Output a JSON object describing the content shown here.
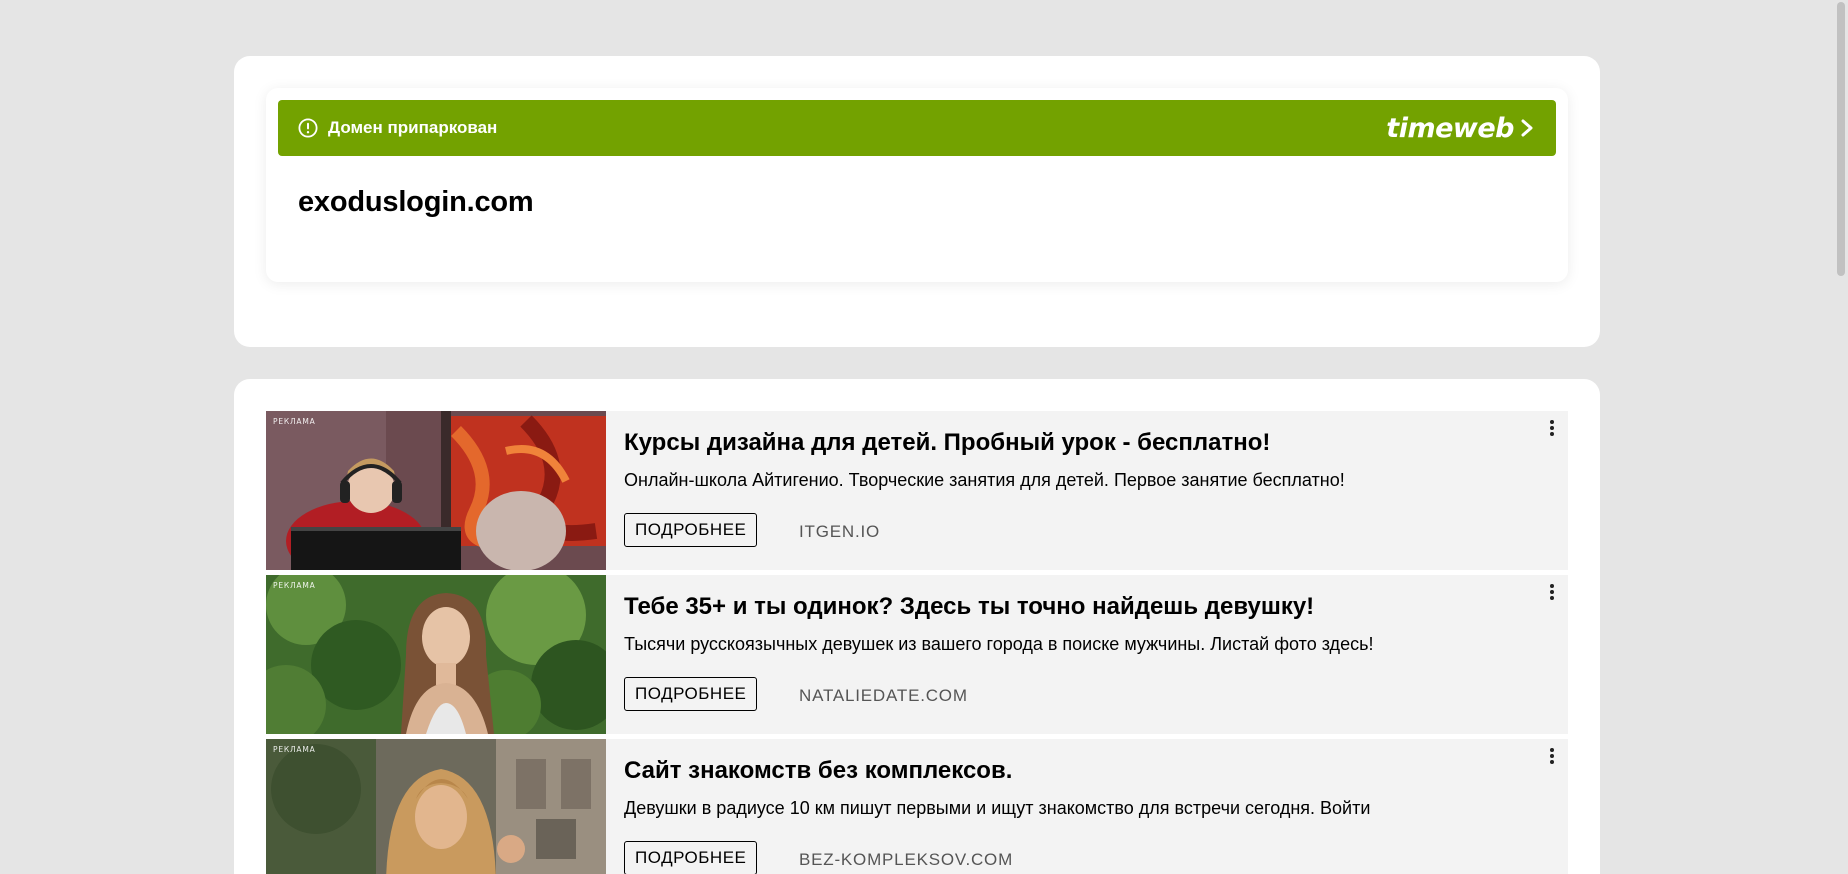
{
  "parking": {
    "notice": "Домен припаркован",
    "brand": "timeweb",
    "domain": "exoduslogin.com",
    "bar_color": "#73a200",
    "icons": {
      "warning": "exclamation-circle-icon",
      "brand_arrow": "chevron-right-icon"
    }
  },
  "ads": [
    {
      "label": "РЕКЛАМА",
      "title": "Курсы дизайна для детей. Пробный урок - бесплатно!",
      "description": "Онлайн-школа Айтигенио. Творческие занятия для детей. Первое занятие бесплатно!",
      "button": "ПОДРОБНЕЕ",
      "domain": "ITGEN.IO"
    },
    {
      "label": "РЕКЛАМА",
      "title": "Тебе 35+ и ты одинок? Здесь ты точно найдешь девушку!",
      "description": "Тысячи русскоязычных девушек из вашего города в поиске мужчины. Листай фото здесь!",
      "button": "ПОДРОБНЕЕ",
      "domain": "NATALIEDATE.COM"
    },
    {
      "label": "РЕКЛАМА",
      "title": "Сайт знакомств без комплексов.",
      "description": "Девушки в радиусе 10 км пишут первыми и ищут знакомство для встречи сегодня. Войти",
      "button": "ПОДРОБНЕЕ",
      "domain": "BEZ-KOMPLEKSOV.COM"
    }
  ],
  "colors": {
    "page_bg": "#e5e5e5",
    "panel_bg": "#ffffff",
    "ad_bg": "#f3f3f3",
    "accent": "#73a200"
  }
}
